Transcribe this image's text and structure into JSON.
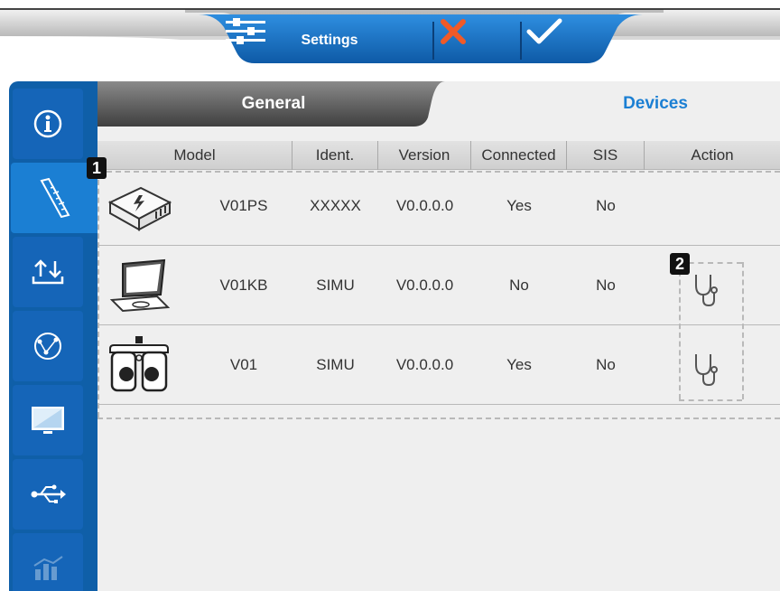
{
  "toolbar": {
    "settings_label": "Settings",
    "settings_icon": "sliders-icon",
    "cancel_icon": "close-icon",
    "confirm_icon": "check-icon",
    "accent": "#1b7fd3",
    "cancel_color": "#f05a28"
  },
  "sidebar": {
    "items": [
      {
        "name": "info",
        "icon": "info-icon"
      },
      {
        "name": "ruler",
        "icon": "ruler-icon",
        "active": true
      },
      {
        "name": "transfer",
        "icon": "upload-download-icon"
      },
      {
        "name": "network",
        "icon": "network-icon"
      },
      {
        "name": "display",
        "icon": "monitor-icon"
      },
      {
        "name": "usb",
        "icon": "usb-icon"
      },
      {
        "name": "stats",
        "icon": "chart-icon"
      }
    ]
  },
  "tabs": {
    "general": "General",
    "devices": "Devices",
    "active": "Devices"
  },
  "table": {
    "columns": [
      "Model",
      "Ident.",
      "Version",
      "Connected",
      "SIS",
      "Action"
    ],
    "rows": [
      {
        "model": "V01PS",
        "ident": "XXXXX",
        "version": "V0.0.0.0",
        "connected": "Yes",
        "sis": "No",
        "device_icon": "power-supply-icon",
        "action_icon": ""
      },
      {
        "model": "V01KB",
        "ident": "SIMU",
        "version": "V0.0.0.0",
        "connected": "No",
        "sis": "No",
        "device_icon": "laptop-icon",
        "action_icon": "stethoscope-icon"
      },
      {
        "model": "V01",
        "ident": "SIMU",
        "version": "V0.0.0.0",
        "connected": "Yes",
        "sis": "No",
        "device_icon": "phoropter-icon",
        "action_icon": "stethoscope-icon"
      }
    ]
  },
  "callouts": [
    "1",
    "2"
  ]
}
